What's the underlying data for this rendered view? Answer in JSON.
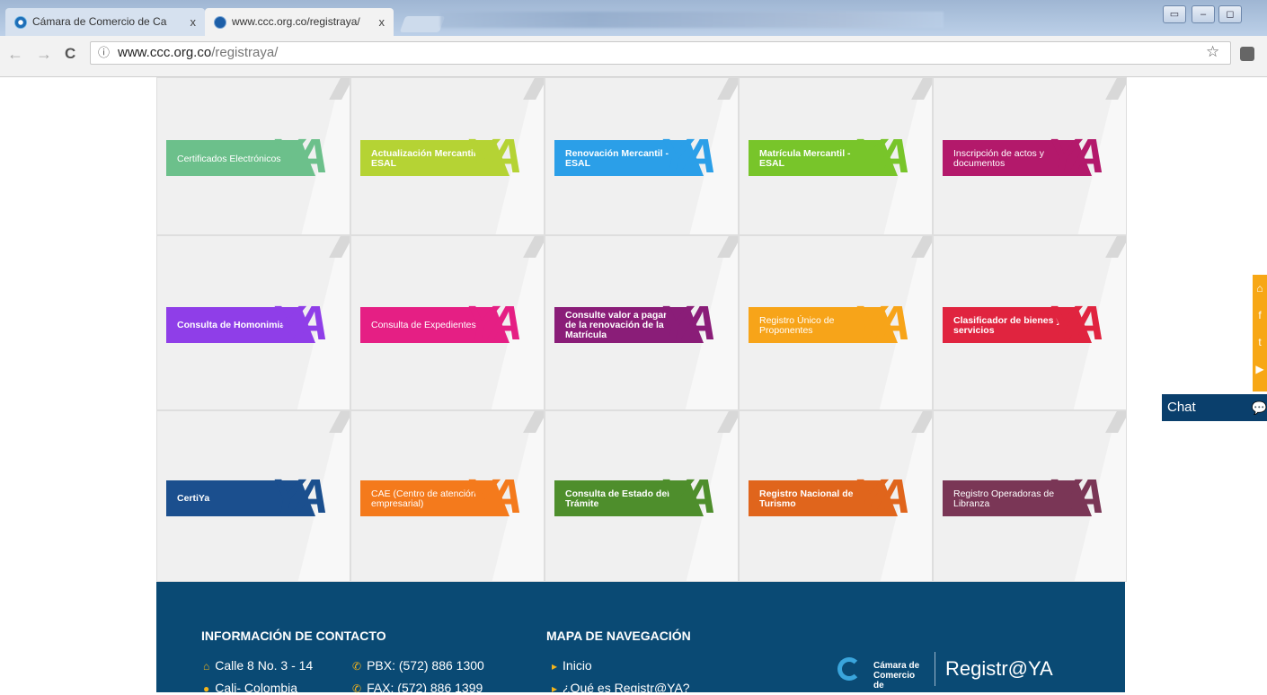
{
  "browser": {
    "tabs": [
      {
        "label": "Cámara de Comercio de Ca",
        "active": false
      },
      {
        "label": "www.ccc.org.co/registraya/",
        "active": true
      }
    ],
    "close_glyph": "x",
    "url_host": "www.ccc.org.co",
    "url_path": "/registraya/",
    "window_controls": [
      "▭",
      "–",
      "◻"
    ]
  },
  "tiles": [
    {
      "label": "Certificados Electrónicos",
      "color": "#6cc08b",
      "bold": false
    },
    {
      "label": "Actualización Mercantil - ESAL",
      "color": "#b5d334",
      "bold": true
    },
    {
      "label": "Renovación Mercantil - ESAL",
      "color": "#2b9fe8",
      "bold": true
    },
    {
      "label": "Matrícula Mercantil - ESAL",
      "color": "#78c52a",
      "bold": true
    },
    {
      "label": "Inscripción de actos y documentos",
      "color": "#b3196b",
      "bold": false
    },
    {
      "label": "Consulta de Homonimia",
      "color": "#8f3ee8",
      "bold": true
    },
    {
      "label": "Consulta de Expedientes",
      "color": "#e51f84",
      "bold": false
    },
    {
      "label": "Consulte valor a pagar de la renovación de la Matrícula",
      "color": "#8a1d78",
      "bold": true
    },
    {
      "label": "Registro Único de Proponentes",
      "color": "#f7a419",
      "bold": false
    },
    {
      "label": "Clasificador de bienes y servicios",
      "color": "#e0243f",
      "bold": true
    },
    {
      "label": "CertiYa",
      "color": "#1b4f8e",
      "bold": true
    },
    {
      "label": "CAE (Centro de atención empresarial)",
      "color": "#f47a1c",
      "bold": false
    },
    {
      "label": "Consulta de Estado del Trámite",
      "color": "#4e8e2c",
      "bold": true
    },
    {
      "label": "Registro Nacional de Turismo",
      "color": "#e0651c",
      "bold": true
    },
    {
      "label": "Registro Operadoras de Libranza",
      "color": "#7a3656",
      "bold": false
    }
  ],
  "ya_text": "YA",
  "chat": {
    "label": "Chat"
  },
  "social_icons": [
    "home-icon",
    "facebook-icon",
    "twitter-icon",
    "youtube-icon"
  ],
  "footer": {
    "contact_title": "INFORMACIÓN DE CONTACTO",
    "address": "Calle 8 No. 3 - 14",
    "city": "Cali- Colombia",
    "pbx": "PBX: (572) 886 1300",
    "fax": "FAX: (572) 886 1399",
    "nav_title": "MAPA DE NAVEGACIÓN",
    "nav_items": [
      "Inicio",
      "¿Qué es Registr@YA?"
    ],
    "brand_camara": "Cámara de Comercio de",
    "brand_registraya": "Registr@YA"
  }
}
